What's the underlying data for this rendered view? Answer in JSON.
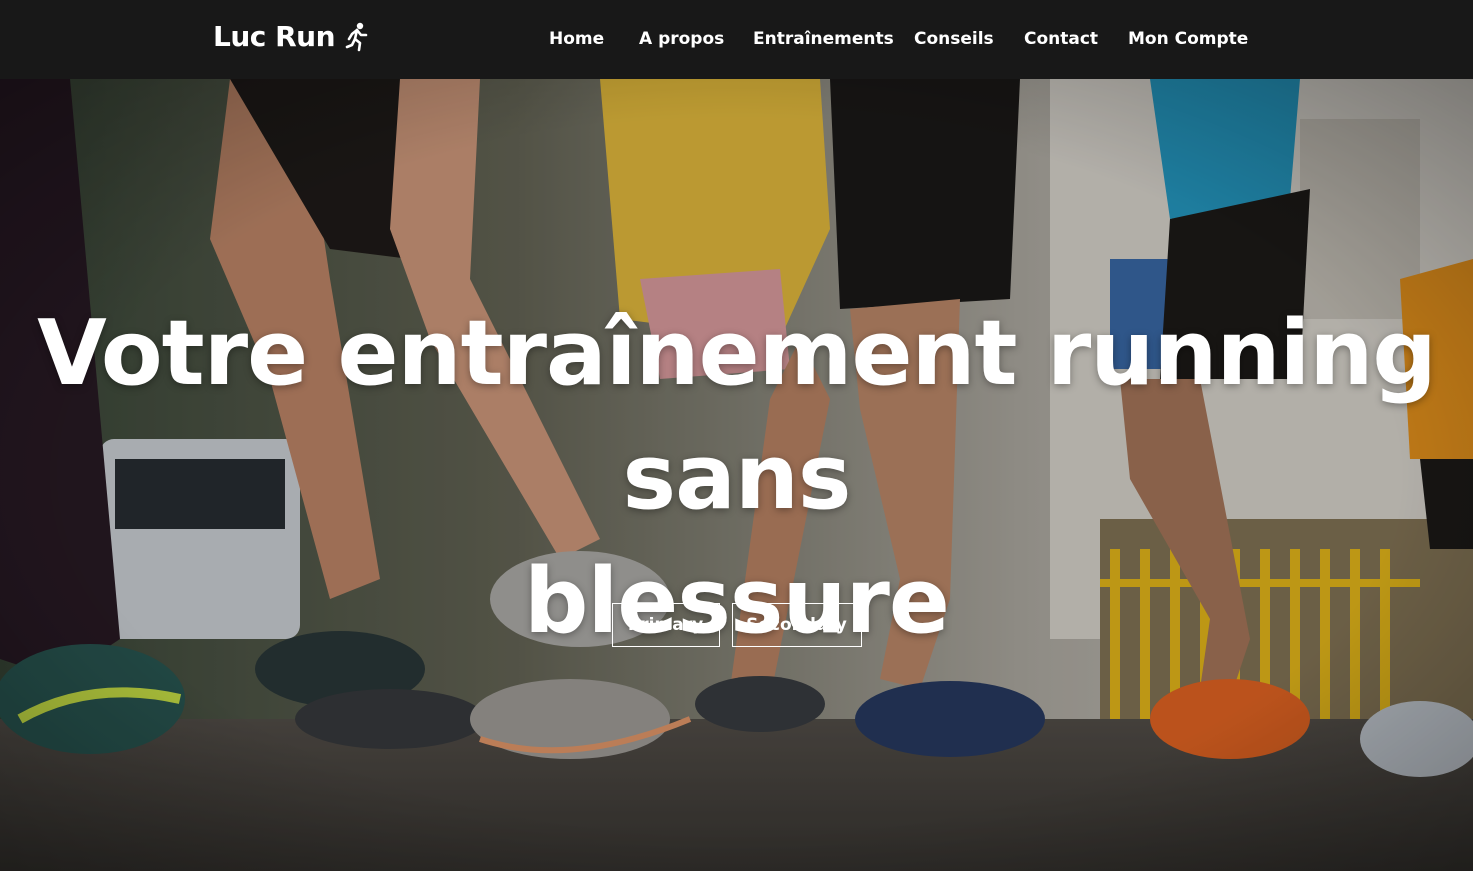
{
  "navbar": {
    "brand": "Luc Run",
    "brand_icon": "running-person-icon",
    "links": [
      "Home",
      "A propos",
      "Entraînements",
      "Conseils",
      "Contact",
      "Mon Compte"
    ]
  },
  "hero": {
    "title_line1": "Votre entraînement running sans",
    "title_line2": "blessure",
    "primary_label": "Primary",
    "secondary_label": "Secondary",
    "background_image": "runners-legs-race-photo"
  },
  "colors": {
    "navbar_bg": "#181818",
    "text": "#ffffff"
  }
}
